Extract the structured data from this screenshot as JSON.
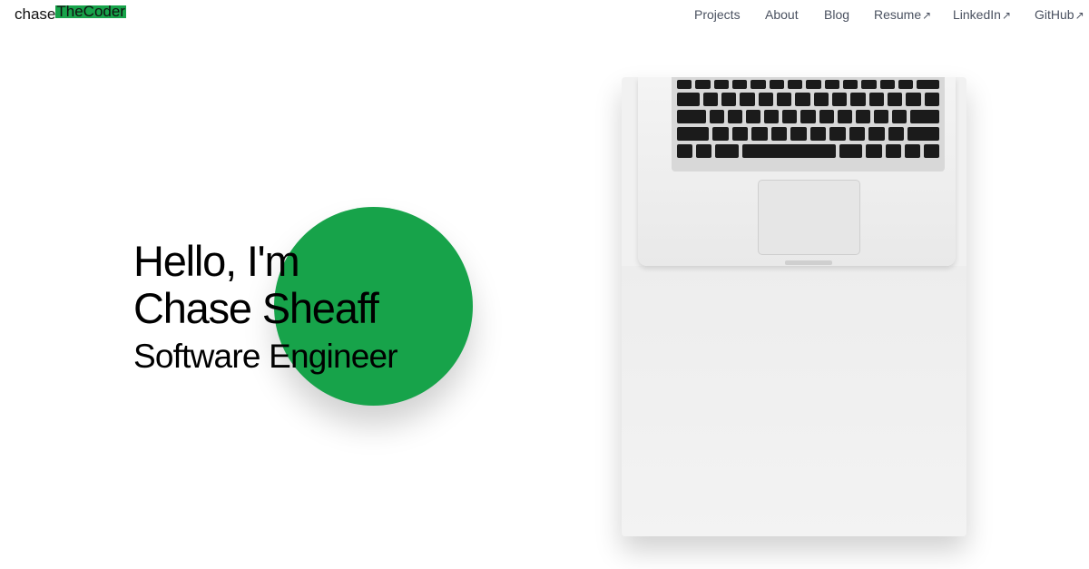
{
  "brand": {
    "prefix": "chase",
    "highlight": "TheCoder",
    "accent": "#17a34a"
  },
  "nav": [
    {
      "label": "Projects",
      "external": false
    },
    {
      "label": "About",
      "external": false
    },
    {
      "label": "Blog",
      "external": false
    },
    {
      "label": "Resume",
      "external": true
    },
    {
      "label": "LinkedIn",
      "external": true
    },
    {
      "label": "GitHub",
      "external": true
    }
  ],
  "nav_external_glyph": "↗",
  "hero": {
    "greeting": "Hello, I'm",
    "name": "Chase Sheaff",
    "role": "Software Engineer"
  },
  "image": {
    "subject": "laptop-keyboard-top-view"
  }
}
